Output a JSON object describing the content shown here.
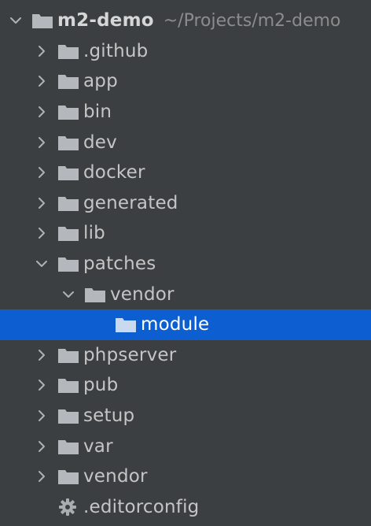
{
  "project_tree": {
    "root": {
      "name": "m2-demo",
      "path": "~/Projects/m2-demo",
      "expanded": true
    },
    "items": [
      {
        "name": ".github",
        "type": "folder",
        "expanded": false
      },
      {
        "name": "app",
        "type": "folder",
        "expanded": false
      },
      {
        "name": "bin",
        "type": "folder",
        "expanded": false
      },
      {
        "name": "dev",
        "type": "folder",
        "expanded": false
      },
      {
        "name": "docker",
        "type": "folder",
        "expanded": false
      },
      {
        "name": "generated",
        "type": "folder",
        "expanded": false
      },
      {
        "name": "lib",
        "type": "folder",
        "expanded": false
      },
      {
        "name": "patches",
        "type": "folder",
        "expanded": true
      },
      {
        "name": "vendor",
        "type": "folder",
        "expanded": true
      },
      {
        "name": "module",
        "type": "folder",
        "selected": true
      },
      {
        "name": "phpserver",
        "type": "folder",
        "expanded": false
      },
      {
        "name": "pub",
        "type": "folder",
        "expanded": false
      },
      {
        "name": "setup",
        "type": "folder",
        "expanded": false
      },
      {
        "name": "var",
        "type": "folder",
        "expanded": false
      },
      {
        "name": "vendor",
        "type": "folder",
        "expanded": false
      },
      {
        "name": ".editorconfig",
        "type": "config-file"
      }
    ]
  },
  "colors": {
    "background": "#3c3f41",
    "selection": "#0d5fd1",
    "folder_icon": "#b4b8bc",
    "text": "#c5c5c5",
    "path_text": "#8c8c8c"
  },
  "icons": {
    "collapsed": "chevron-right-icon",
    "expanded": "chevron-down-icon",
    "folder": "folder-icon",
    "config": "gear-icon"
  }
}
